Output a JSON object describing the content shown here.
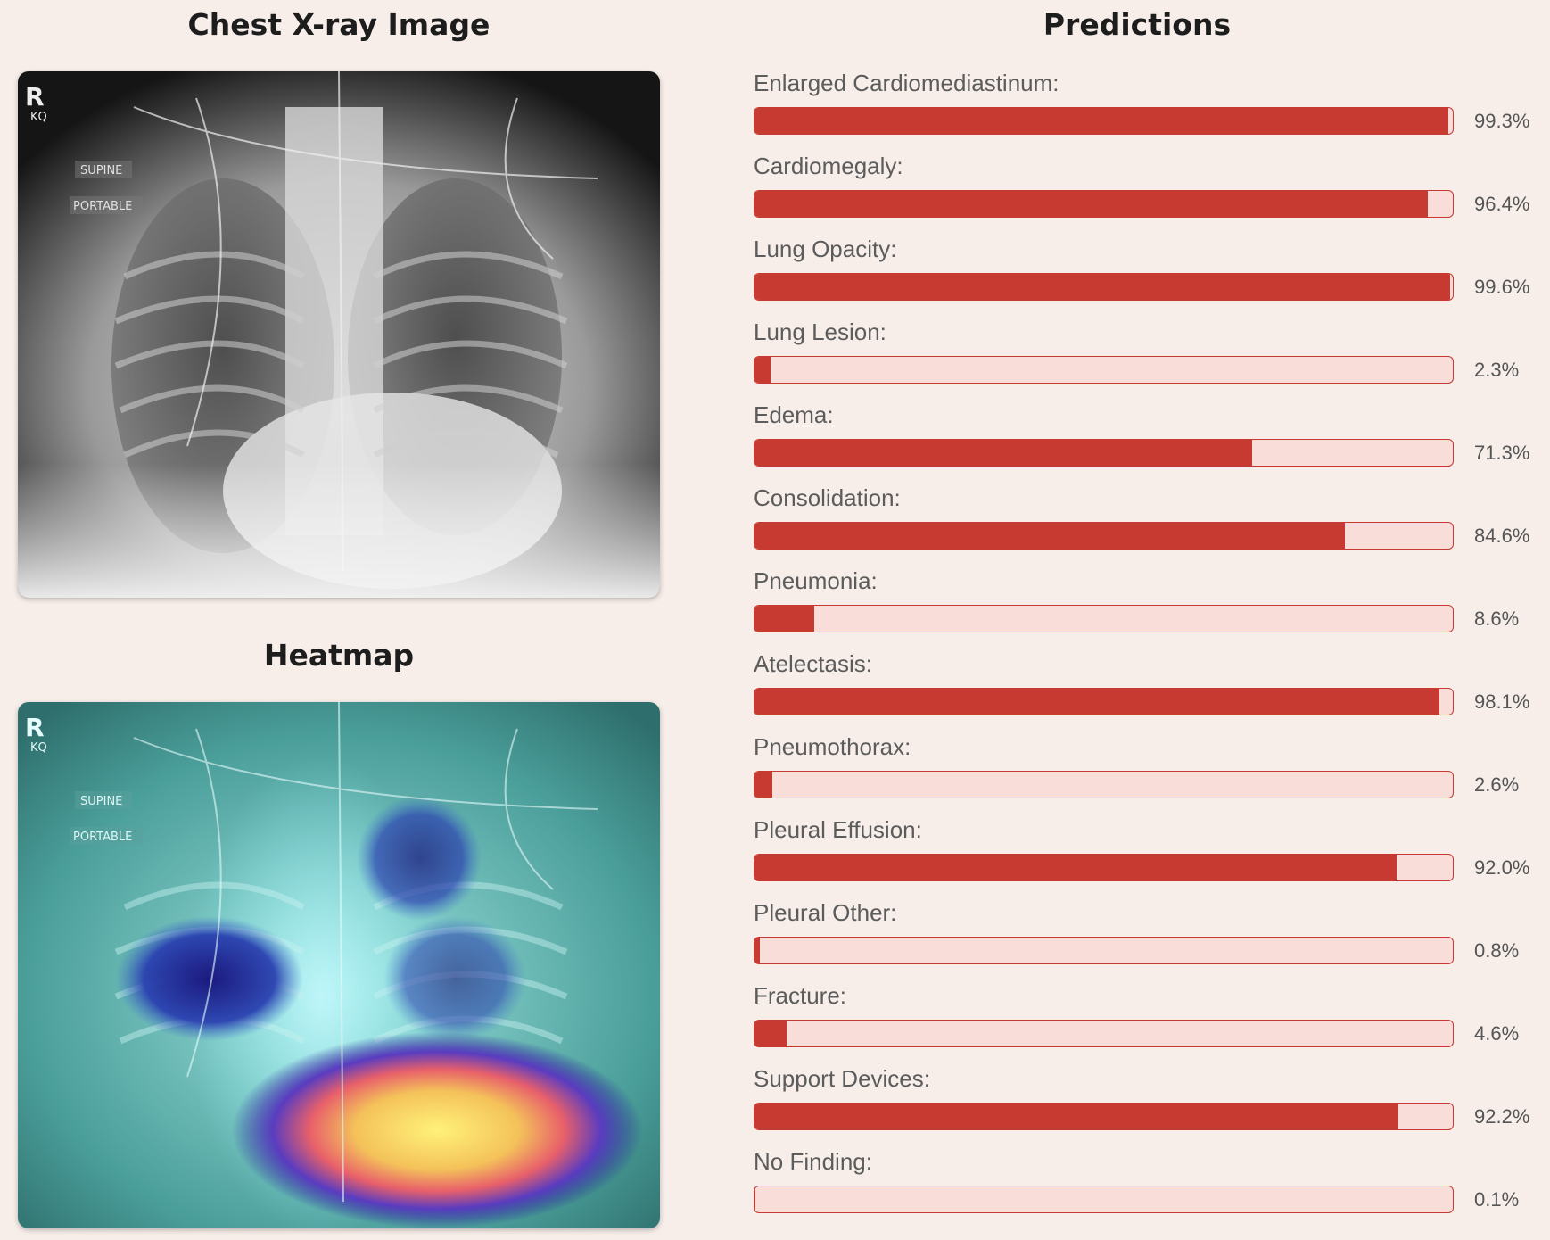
{
  "left_panel": {
    "xray_title": "Chest X-ray Image",
    "heatmap_title": "Heatmap",
    "image_markers": {
      "side": "R",
      "initials": "KQ",
      "position": "SUPINE",
      "mode": "PORTABLE"
    }
  },
  "right_panel": {
    "title": "Predictions",
    "bar_color": "#c73a31",
    "track_color": "#f8ddd8",
    "predictions": [
      {
        "label": "Enlarged Cardiomediastinum:",
        "value": "99.3%",
        "fraction": 0.993
      },
      {
        "label": "Cardiomegaly:",
        "value": "96.4%",
        "fraction": 0.964
      },
      {
        "label": "Lung Opacity:",
        "value": "99.6%",
        "fraction": 0.996
      },
      {
        "label": "Lung Lesion:",
        "value": "2.3%",
        "fraction": 0.023
      },
      {
        "label": "Edema:",
        "value": "71.3%",
        "fraction": 0.713
      },
      {
        "label": "Consolidation:",
        "value": "84.6%",
        "fraction": 0.846
      },
      {
        "label": "Pneumonia:",
        "value": "8.6%",
        "fraction": 0.086
      },
      {
        "label": "Atelectasis:",
        "value": "98.1%",
        "fraction": 0.981
      },
      {
        "label": "Pneumothorax:",
        "value": "2.6%",
        "fraction": 0.026
      },
      {
        "label": "Pleural Effusion:",
        "value": "92.0%",
        "fraction": 0.92
      },
      {
        "label": "Pleural Other:",
        "value": "0.8%",
        "fraction": 0.008
      },
      {
        "label": "Fracture:",
        "value": "4.6%",
        "fraction": 0.046
      },
      {
        "label": "Support Devices:",
        "value": "92.2%",
        "fraction": 0.922
      },
      {
        "label": "No Finding:",
        "value": "0.1%",
        "fraction": 0.001
      }
    ]
  }
}
